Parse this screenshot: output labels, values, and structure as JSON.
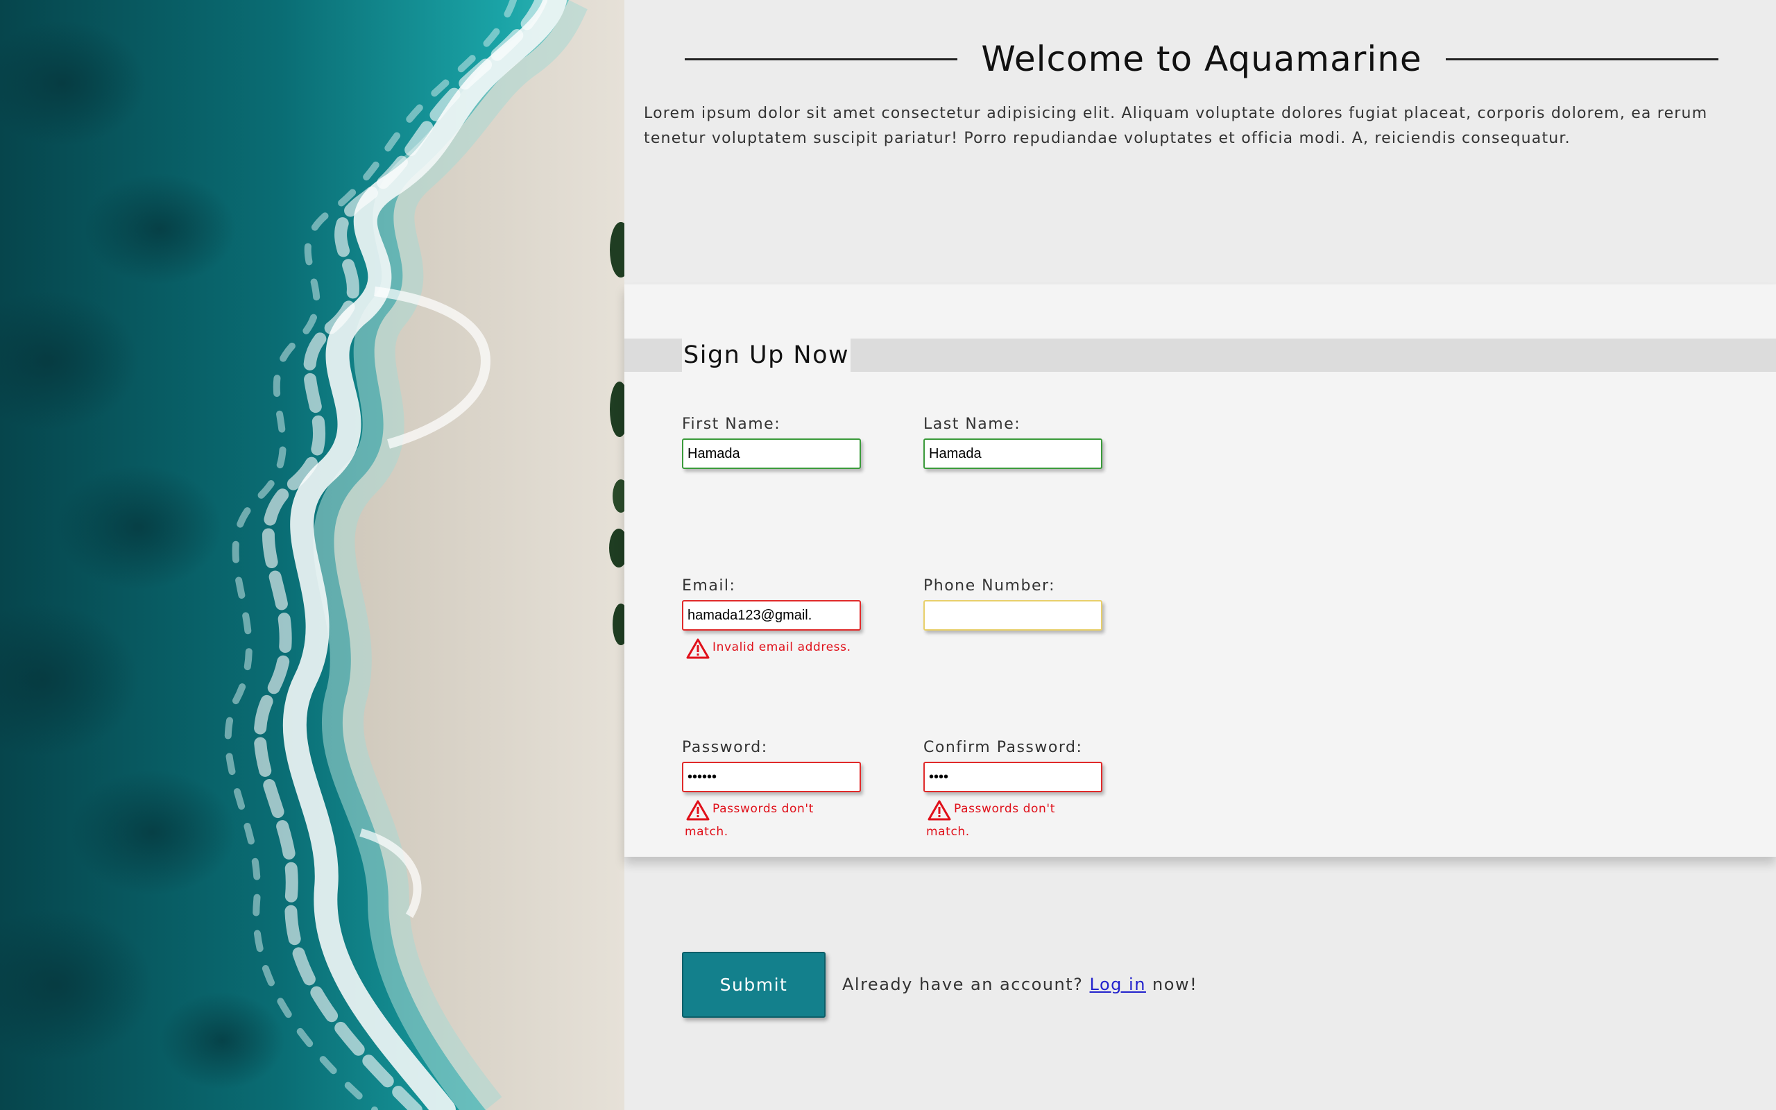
{
  "hero": {
    "title": "Welcome to Aquamarine",
    "intro": "Lorem ipsum dolor sit amet consectetur adipisicing elit. Aliquam voluptate dolores fugiat placeat, corporis dolorem, ea rerum tenetur voluptatem suscipit pariatur! Porro repudiandae voluptates et officia modi. A, reiciendis consequatur."
  },
  "form": {
    "heading": "Sign Up Now",
    "first_name": {
      "label": "First Name:",
      "value": "Hamada",
      "state": "valid"
    },
    "last_name": {
      "label": "Last Name:",
      "value": "Hamada",
      "state": "valid"
    },
    "email": {
      "label": "Email:",
      "value": "hamada123@gmail.",
      "state": "invalid",
      "error": "Invalid email address."
    },
    "phone": {
      "label": "Phone Number:",
      "value": "",
      "state": "pending"
    },
    "password": {
      "label": "Password:",
      "value": "••••••",
      "state": "invalid",
      "error_line1": "Passwords don't",
      "error_line2": "match."
    },
    "confirm_password": {
      "label": "Confirm Password:",
      "value": "••••",
      "state": "invalid",
      "error_line1": "Passwords don't",
      "error_line2": "match."
    }
  },
  "actions": {
    "submit_label": "Submit",
    "login_prefix": "Already have an account?",
    "login_link": "Log in",
    "login_suffix": "now!"
  },
  "colors": {
    "accent": "#13808c",
    "valid": "#3a9a3a",
    "error": "#e0101a",
    "pending": "#e8cf6a",
    "link": "#2222cc"
  },
  "icons": {
    "warning": "warning-triangle-icon"
  }
}
